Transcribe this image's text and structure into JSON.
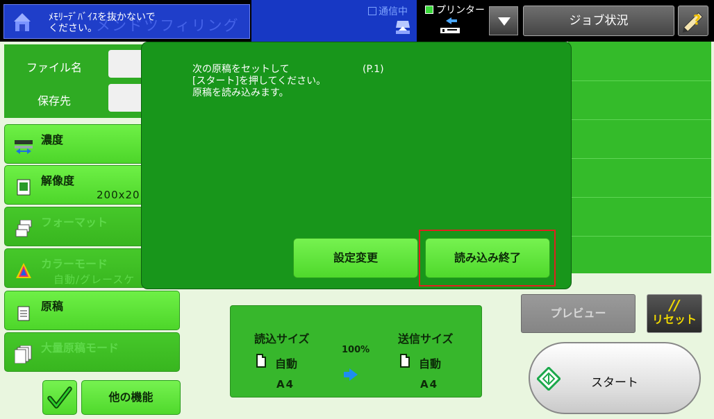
{
  "header": {
    "title_ghost": "メンドツフィリング",
    "notice": "ﾒﾓﾘｰﾃﾞﾊﾞｲｽを抜かないで\nください。",
    "comm_status": "通信中",
    "printer_label": "プリンター",
    "job_status_label": "ジョブ状況"
  },
  "fields": {
    "filename_label": "ファイル名",
    "destination_label": "保存先"
  },
  "menu": {
    "density": {
      "label": "濃度"
    },
    "resolution": {
      "label": "解像度",
      "value": "200x20"
    },
    "format": {
      "label": "フォーマット"
    },
    "color_mode": {
      "label": "カラーモード",
      "value": "自動/グレースケ"
    },
    "original": {
      "label": "原稿"
    },
    "bulk_mode": {
      "label": "大量原稿モード"
    }
  },
  "dialog": {
    "message": "次の原稿をセットして\n[スタート]を押してください。\n原稿を読み込みます。",
    "page": "(P.1)",
    "settings_button": "設定変更",
    "finish_button": "読み込み終了"
  },
  "size_panel": {
    "scan_size_label": "読込サイズ",
    "send_size_label": "送信サイズ",
    "scan_mode": "自動",
    "send_mode": "自動",
    "scan_paper": "A4",
    "send_paper": "A4",
    "ratio": "100%"
  },
  "actions": {
    "preview_label": "プレビュー",
    "reset_slashes": "//",
    "reset_label": "リセット",
    "start_label": "スタート",
    "other_functions_label": "他の機能"
  },
  "colors": {
    "dialog_bg": "#18961b",
    "button_green": "#5ee33a",
    "highlight": "#e22020",
    "header_blue": "#1f3ec9"
  }
}
